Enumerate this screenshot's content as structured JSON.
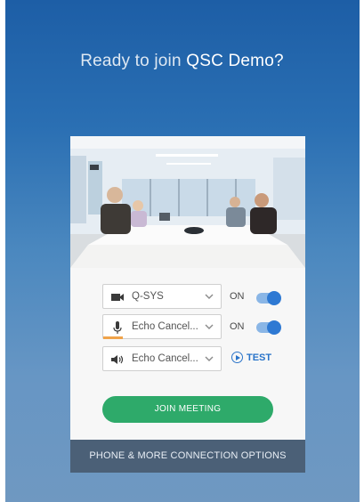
{
  "header": {
    "title_prefix": "Ready to join",
    "meeting_name": "QSC Demo?"
  },
  "controls": {
    "camera": {
      "icon": "video-camera-icon",
      "label": "Q-SYS",
      "status": "ON"
    },
    "microphone": {
      "icon": "microphone-icon",
      "label": "Echo Cancel...",
      "status": "ON"
    },
    "speaker": {
      "icon": "speaker-icon",
      "label": "Echo Cancel...",
      "test_label": "TEST"
    }
  },
  "actions": {
    "join_label": "JOIN MEETING",
    "more_options_label": "PHONE & MORE CONNECTION OPTIONS"
  },
  "colors": {
    "join_button": "#2eaa6a",
    "toggle_on": "#2e79d3",
    "accent_link": "#2a74c9",
    "footer_bar": "#4b6077"
  }
}
